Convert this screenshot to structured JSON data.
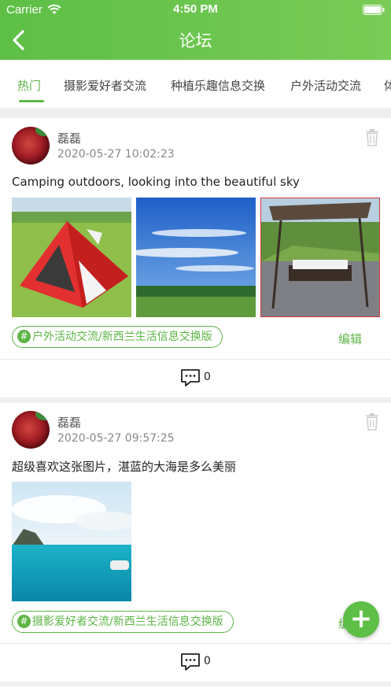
{
  "status_bar": {
    "carrier": "Carrier",
    "time": "4:50 PM"
  },
  "nav": {
    "title": "论坛"
  },
  "tabs": [
    {
      "label": "热门",
      "active": true
    },
    {
      "label": "摄影爱好者交流",
      "active": false
    },
    {
      "label": "种植乐趣信息交换",
      "active": false
    },
    {
      "label": "户外活动交流",
      "active": false
    },
    {
      "label": "体",
      "active": false
    }
  ],
  "posts": [
    {
      "author": "磊磊",
      "date": "2020-05-27 10:02:23",
      "content": "Camping outdoors, looking into the beautiful sky",
      "images": [
        "red-tent-photo",
        "blue-sky-field-photo",
        "garden-swing-photo"
      ],
      "tag_hash": "#",
      "tag": "户外活动交流/新西兰生活信息交换版",
      "edit_label": "编辑",
      "comment_count": "0"
    },
    {
      "author": "磊磊",
      "date": "2020-05-27 09:57:25",
      "content": "超级喜欢这张图片，湛蓝的大海是多么美丽",
      "images": [
        "turquoise-sea-photo"
      ],
      "tag_hash": "#",
      "tag": "摄影爱好者交流/新西兰生活信息交换版",
      "edit_label": "编辑",
      "comment_count": "0"
    }
  ],
  "fab": {
    "label": "+"
  },
  "colors": {
    "accent": "#5cb545",
    "header_start": "#5dbf46",
    "header_end": "#7acb56"
  }
}
